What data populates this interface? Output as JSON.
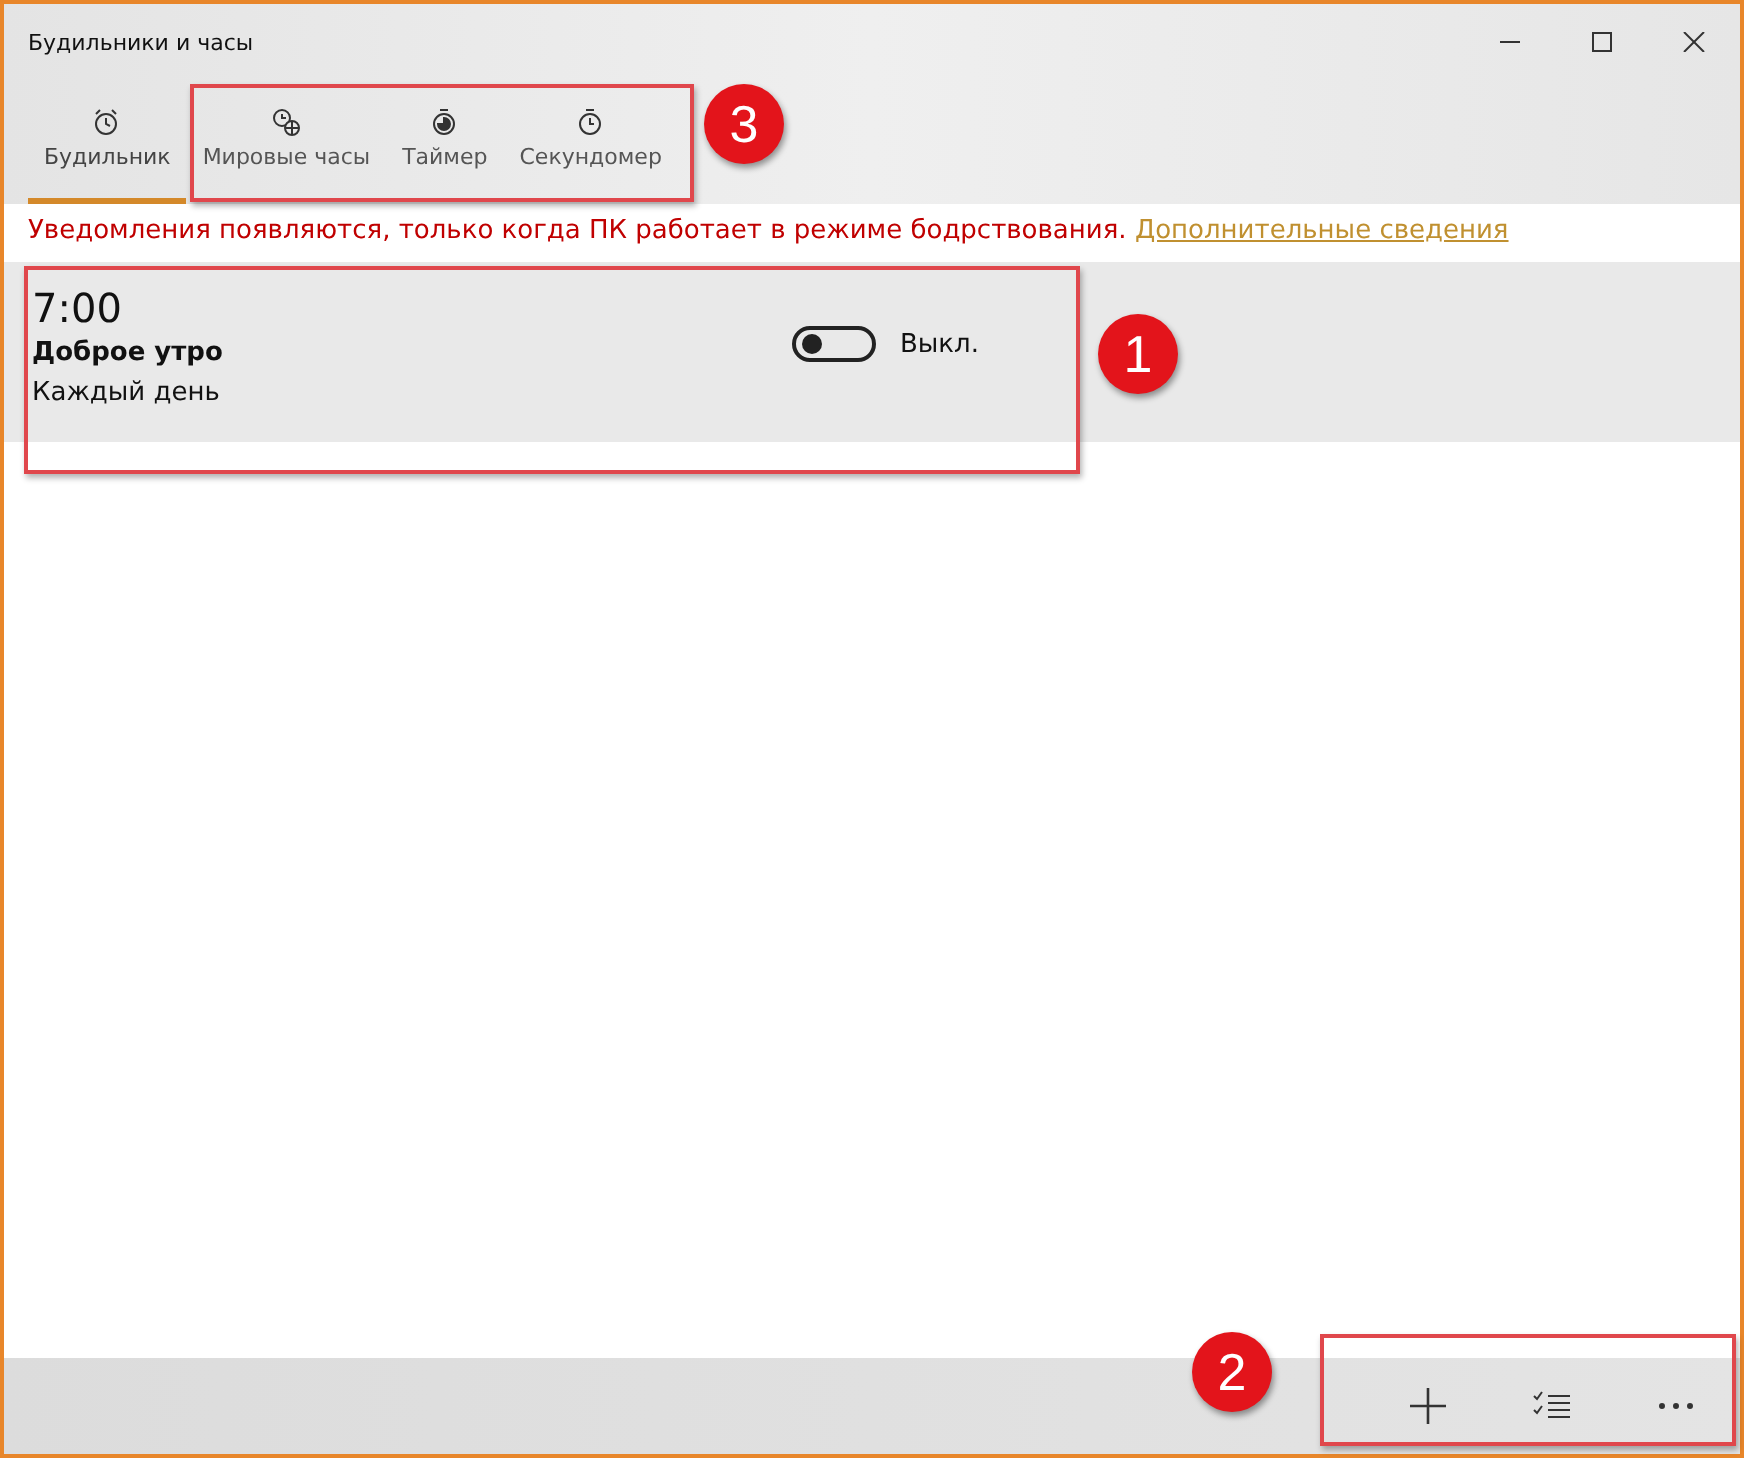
{
  "window": {
    "title": "Будильники и часы"
  },
  "tabs": [
    {
      "kind": "alarm",
      "label": "Будильник",
      "selected": true
    },
    {
      "kind": "world",
      "label": "Мировые часы",
      "selected": false
    },
    {
      "kind": "timer",
      "label": "Таймер",
      "selected": false
    },
    {
      "kind": "stopwatch",
      "label": "Секундомер",
      "selected": false
    }
  ],
  "notice": {
    "text": "Уведомления появляются, только когда ПК работает в режиме бодрствования.",
    "link": "Дополнительные сведения"
  },
  "alarms": [
    {
      "time": "7:00",
      "name": "Доброе утро",
      "repeat": "Каждый день",
      "on": false,
      "state_label": "Выкл."
    }
  ],
  "command_bar": [
    {
      "kind": "add"
    },
    {
      "kind": "select"
    },
    {
      "kind": "more"
    }
  ],
  "annotations": [
    {
      "label": "1",
      "kind": "alarms"
    },
    {
      "label": "2",
      "kind": "command_bar"
    },
    {
      "label": "3",
      "kind": "tabs"
    }
  ]
}
